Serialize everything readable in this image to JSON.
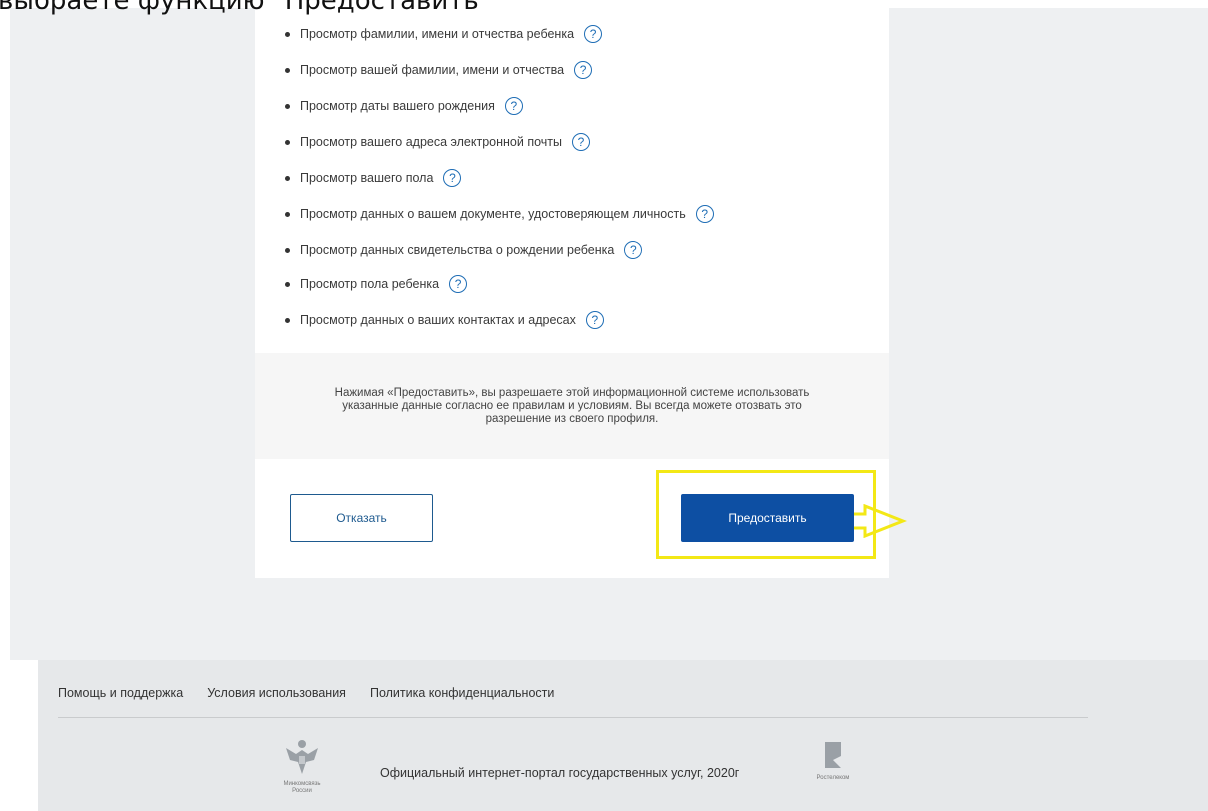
{
  "overlay": {
    "caption": "выбраете функцию \"Предоставить\""
  },
  "permissions": [
    "Просмотр фамилии, имени и отчества ребенка",
    "Просмотр вашей фамилии, имени и отчества",
    "Просмотр даты вашего рождения",
    "Просмотр вашего адреса электронной почты",
    "Просмотр вашего пола",
    "Просмотр данных о вашем документе, удостоверяющем личность",
    "Просмотр данных свидетельства о рождении ребенка",
    "Просмотр пола ребенка",
    "Просмотр данных о ваших контактах и адресах"
  ],
  "help_icon_glyph": "?",
  "consent": {
    "line1": "Нажимая «Предоставить», вы разрешаете этой информационной системе использовать",
    "line2": "указанные данные согласно ее правилам и условиям. Вы всегда можете отозвать это",
    "line3": "разрешение из своего профиля."
  },
  "actions": {
    "refuse_label": "Отказать",
    "grant_label": "Предоставить"
  },
  "footer": {
    "links": [
      "Помощь и поддержка",
      "Условия использования",
      "Политика конфиденциальности"
    ],
    "portal_text": "Официальный интернет-портал государственных услуг, 2020г",
    "mincom_caption_1": "Минкомсвязь",
    "mincom_caption_2": "России",
    "rostelecom_caption": "Ростелеком"
  },
  "colors": {
    "primary": "#0d4fa3",
    "highlight": "#f3e816",
    "help": "#1e6db5"
  }
}
